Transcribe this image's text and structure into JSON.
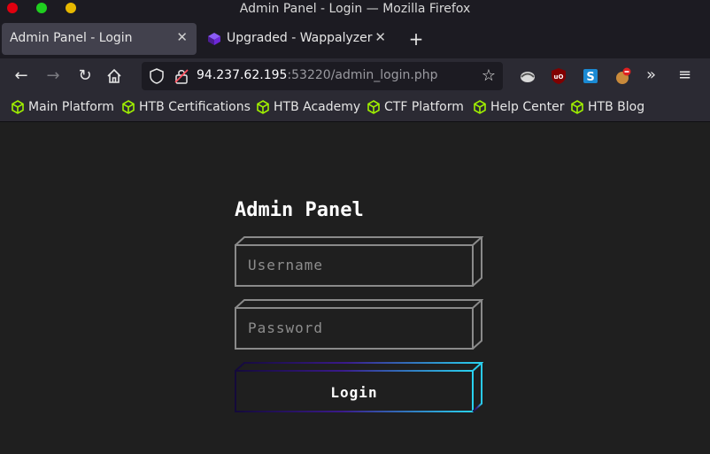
{
  "window": {
    "title": "Admin Panel - Login — Mozilla Firefox"
  },
  "tabs": [
    {
      "label": "Admin Panel - Login",
      "active": true
    },
    {
      "label": "Upgraded - Wappalyzer",
      "active": false
    }
  ],
  "nav": {
    "url_host": "94.237.62.195",
    "url_rest": ":53220/admin_login.php"
  },
  "bookmarks": [
    {
      "label": "Main Platform"
    },
    {
      "label": "HTB Certifications"
    },
    {
      "label": "HTB Academy"
    },
    {
      "label": "CTF Platform"
    },
    {
      "label": "Help Center"
    },
    {
      "label": "HTB Blog"
    }
  ],
  "page": {
    "title": "Admin Panel",
    "username_placeholder": "Username",
    "password_placeholder": "Password",
    "login_label": "Login"
  },
  "colors": {
    "accent_cyan": "#29d3f0",
    "accent_purple": "#3a1a8a",
    "htb_green": "#9fef00"
  }
}
